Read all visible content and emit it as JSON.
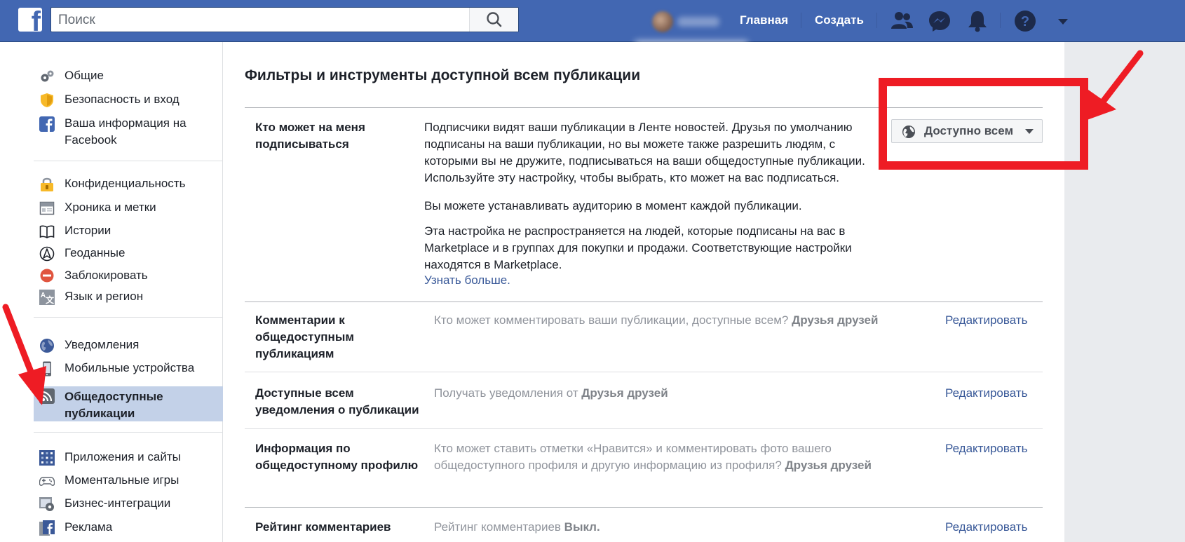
{
  "topbar": {
    "search_placeholder": "Поиск",
    "nav_links": [
      "Главная",
      "Создать"
    ]
  },
  "sidebar": {
    "items": [
      {
        "label": "Общие",
        "icon": "gears-icon"
      },
      {
        "label": "Безопасность и вход",
        "icon": "shield-icon"
      },
      {
        "label": "Ваша информация на Facebook",
        "icon": "facebook-square-icon"
      },
      {
        "label": "Конфиденциальность",
        "icon": "lock-icon"
      },
      {
        "label": "Хроника и метки",
        "icon": "timeline-icon"
      },
      {
        "label": "Истории",
        "icon": "book-icon"
      },
      {
        "label": "Геоданные",
        "icon": "location-icon"
      },
      {
        "label": "Заблокировать",
        "icon": "block-icon"
      },
      {
        "label": "Язык и регион",
        "icon": "language-icon"
      },
      {
        "label": "Уведомления",
        "icon": "globe-icon"
      },
      {
        "label": "Мобильные устройства",
        "icon": "mobile-icon"
      },
      {
        "label": "Общедоступные публикации",
        "icon": "rss-icon",
        "active": true
      },
      {
        "label": "Приложения и сайты",
        "icon": "apps-icon"
      },
      {
        "label": "Моментальные игры",
        "icon": "gamepad-icon"
      },
      {
        "label": "Бизнес-интеграции",
        "icon": "business-gear-icon"
      },
      {
        "label": "Реклама",
        "icon": "ads-icon"
      }
    ]
  },
  "main": {
    "title": "Фильтры и инструменты доступной всем публикации",
    "follow": {
      "label": "Кто может на меня подписываться",
      "paragraphs": [
        "Подписчики видят ваши публикации в Ленте новостей. Друзья по умолчанию подписаны на ваши публикации, но вы можете также разрешить людям, с которыми вы не дружите, подписываться на ваши общедоступные публикации. Используйте эту настройку, чтобы выбрать, кто может на вас подписаться.",
        "Вы можете устанавливать аудиторию в момент каждой публикации.",
        "Эта настройка не распространяется на людей, которые подписаны на вас в Marketplace и в группах для покупки и продажи. Соответствующие настройки находятся в Marketplace."
      ],
      "learn_more": "Узнать больше.",
      "audience": "Доступно всем"
    },
    "rows": [
      {
        "label": "Комментарии к общедоступным публикациям",
        "desc": "Кто может комментировать ваши публикации, доступные всем?",
        "value": "Друзья друзей",
        "edit": "Редактировать"
      },
      {
        "label": "Доступные всем уведомления о публикации",
        "desc": "Получать уведомления от",
        "value": "Друзья друзей",
        "edit": "Редактировать"
      },
      {
        "label": "Информация по общедоступному профилю",
        "desc": "Кто может ставить отметки «Нравится» и комментировать фото вашего общедоступного профиля и другую информацию из профиля?",
        "value": "Друзья друзей",
        "edit": "Редактировать"
      },
      {
        "label": "Рейтинг комментариев",
        "desc": "Рейтинг комментариев",
        "value": "Выкл.",
        "edit": "Редактировать"
      }
    ]
  },
  "colors": {
    "topbar": "#4267b2",
    "link": "#385898",
    "active_item": "#c3d1e8",
    "annotation_red": "#ee1c24"
  }
}
